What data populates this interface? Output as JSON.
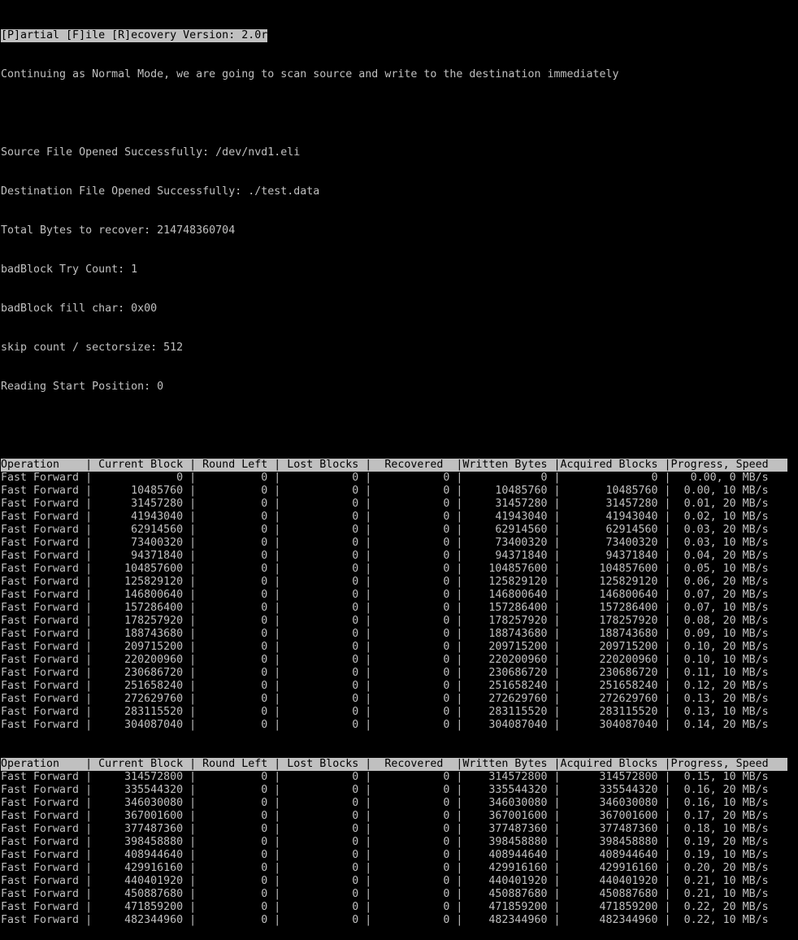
{
  "title_bar": "[P]artial [F]ile [R]ecovery Version: 2.0r",
  "mode_line": "Continuing as Normal Mode, we are going to scan source and write to the destination immediately",
  "info_lines": [
    "Source File Opened Successfully: /dev/nvd1.eli",
    "Destination File Opened Successfully: ./test.data",
    "Total Bytes to recover: 214748360704",
    "badBlock Try Count: 1",
    "badBlock fill char: 0x00",
    "skip count / sectorsize: 512",
    "Reading Start Position: 0"
  ],
  "table_header": {
    "columns": [
      "Operation",
      "Current Block",
      "Round Left",
      "Lost Blocks",
      "Recovered",
      "Written Bytes",
      "Acquired Blocks",
      "Progress, Speed"
    ]
  },
  "rows_block1": [
    [
      "Fast Forward",
      "0",
      "0",
      "0",
      "0",
      "0",
      "0",
      "0.00, 0 MB/s"
    ],
    [
      "Fast Forward",
      "10485760",
      "0",
      "0",
      "0",
      "10485760",
      "10485760",
      "0.00, 10 MB/s"
    ],
    [
      "Fast Forward",
      "31457280",
      "0",
      "0",
      "0",
      "31457280",
      "31457280",
      "0.01, 20 MB/s"
    ],
    [
      "Fast Forward",
      "41943040",
      "0",
      "0",
      "0",
      "41943040",
      "41943040",
      "0.02, 10 MB/s"
    ],
    [
      "Fast Forward",
      "62914560",
      "0",
      "0",
      "0",
      "62914560",
      "62914560",
      "0.03, 20 MB/s"
    ],
    [
      "Fast Forward",
      "73400320",
      "0",
      "0",
      "0",
      "73400320",
      "73400320",
      "0.03, 10 MB/s"
    ],
    [
      "Fast Forward",
      "94371840",
      "0",
      "0",
      "0",
      "94371840",
      "94371840",
      "0.04, 20 MB/s"
    ],
    [
      "Fast Forward",
      "104857600",
      "0",
      "0",
      "0",
      "104857600",
      "104857600",
      "0.05, 10 MB/s"
    ],
    [
      "Fast Forward",
      "125829120",
      "0",
      "0",
      "0",
      "125829120",
      "125829120",
      "0.06, 20 MB/s"
    ],
    [
      "Fast Forward",
      "146800640",
      "0",
      "0",
      "0",
      "146800640",
      "146800640",
      "0.07, 20 MB/s"
    ],
    [
      "Fast Forward",
      "157286400",
      "0",
      "0",
      "0",
      "157286400",
      "157286400",
      "0.07, 10 MB/s"
    ],
    [
      "Fast Forward",
      "178257920",
      "0",
      "0",
      "0",
      "178257920",
      "178257920",
      "0.08, 20 MB/s"
    ],
    [
      "Fast Forward",
      "188743680",
      "0",
      "0",
      "0",
      "188743680",
      "188743680",
      "0.09, 10 MB/s"
    ],
    [
      "Fast Forward",
      "209715200",
      "0",
      "0",
      "0",
      "209715200",
      "209715200",
      "0.10, 20 MB/s"
    ],
    [
      "Fast Forward",
      "220200960",
      "0",
      "0",
      "0",
      "220200960",
      "220200960",
      "0.10, 10 MB/s"
    ],
    [
      "Fast Forward",
      "230686720",
      "0",
      "0",
      "0",
      "230686720",
      "230686720",
      "0.11, 10 MB/s"
    ],
    [
      "Fast Forward",
      "251658240",
      "0",
      "0",
      "0",
      "251658240",
      "251658240",
      "0.12, 20 MB/s"
    ],
    [
      "Fast Forward",
      "272629760",
      "0",
      "0",
      "0",
      "272629760",
      "272629760",
      "0.13, 20 MB/s"
    ],
    [
      "Fast Forward",
      "283115520",
      "0",
      "0",
      "0",
      "283115520",
      "283115520",
      "0.13, 10 MB/s"
    ],
    [
      "Fast Forward",
      "304087040",
      "0",
      "0",
      "0",
      "304087040",
      "304087040",
      "0.14, 20 MB/s"
    ]
  ],
  "rows_block2": [
    [
      "Fast Forward",
      "314572800",
      "0",
      "0",
      "0",
      "314572800",
      "314572800",
      "0.15, 10 MB/s"
    ],
    [
      "Fast Forward",
      "335544320",
      "0",
      "0",
      "0",
      "335544320",
      "335544320",
      "0.16, 20 MB/s"
    ],
    [
      "Fast Forward",
      "346030080",
      "0",
      "0",
      "0",
      "346030080",
      "346030080",
      "0.16, 10 MB/s"
    ],
    [
      "Fast Forward",
      "367001600",
      "0",
      "0",
      "0",
      "367001600",
      "367001600",
      "0.17, 20 MB/s"
    ],
    [
      "Fast Forward",
      "377487360",
      "0",
      "0",
      "0",
      "377487360",
      "377487360",
      "0.18, 10 MB/s"
    ],
    [
      "Fast Forward",
      "398458880",
      "0",
      "0",
      "0",
      "398458880",
      "398458880",
      "0.19, 20 MB/s"
    ],
    [
      "Fast Forward",
      "408944640",
      "0",
      "0",
      "0",
      "408944640",
      "408944640",
      "0.19, 10 MB/s"
    ],
    [
      "Fast Forward",
      "429916160",
      "0",
      "0",
      "0",
      "429916160",
      "429916160",
      "0.20, 20 MB/s"
    ],
    [
      "Fast Forward",
      "440401920",
      "0",
      "0",
      "0",
      "440401920",
      "440401920",
      "0.21, 10 MB/s"
    ],
    [
      "Fast Forward",
      "450887680",
      "0",
      "0",
      "0",
      "450887680",
      "450887680",
      "0.21, 10 MB/s"
    ],
    [
      "Fast Forward",
      "471859200",
      "0",
      "0",
      "0",
      "471859200",
      "471859200",
      "0.22, 20 MB/s"
    ],
    [
      "Fast Forward",
      "482344960",
      "0",
      "0",
      "0",
      "482344960",
      "482344960",
      "0.22, 10 MB/s"
    ]
  ],
  "colors": {
    "background": "#000000",
    "foreground": "#c0c0c0",
    "inverse_bg": "#c0c0c0",
    "inverse_fg": "#000000"
  }
}
